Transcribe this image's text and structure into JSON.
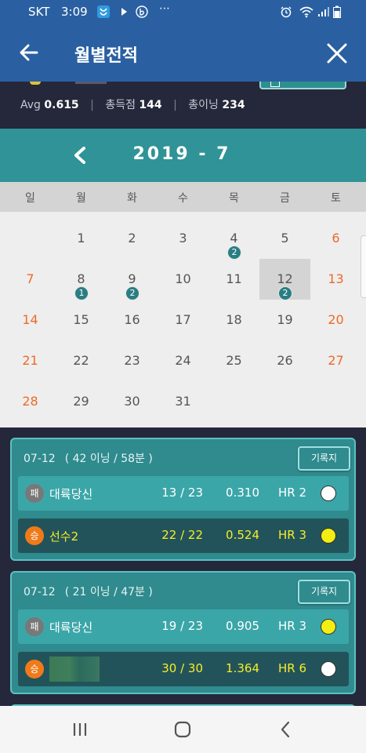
{
  "status_bar": {
    "carrier": "SKT",
    "time": "3:09",
    "dots": "⋯",
    "icons": [
      "notification-icon",
      "play-icon",
      "b-app-icon",
      "alarm-icon",
      "wifi-icon",
      "signal-icon",
      "battery-icon"
    ]
  },
  "app_bar": {
    "title": "월별전적",
    "back_icon": "arrow-left-icon",
    "close_icon": "close-icon"
  },
  "summary": {
    "avg_label": "Avg",
    "avg_value": "0.615",
    "runs_label": "총득점",
    "runs_value": "144",
    "innings_label": "총이닝",
    "innings_value": "234",
    "sep": "|"
  },
  "calendar": {
    "month_label": "2019 - 7",
    "weekdays": [
      "일",
      "월",
      "화",
      "수",
      "목",
      "금",
      "토"
    ],
    "days": [
      {
        "d": "1",
        "col": 1,
        "row": 0
      },
      {
        "d": "2",
        "col": 2,
        "row": 0
      },
      {
        "d": "3",
        "col": 3,
        "row": 0
      },
      {
        "d": "4",
        "col": 4,
        "row": 0,
        "badge": "2"
      },
      {
        "d": "5",
        "col": 5,
        "row": 0
      },
      {
        "d": "6",
        "col": 6,
        "row": 0
      },
      {
        "d": "7",
        "col": 0,
        "row": 1
      },
      {
        "d": "8",
        "col": 1,
        "row": 1,
        "badge": "1"
      },
      {
        "d": "9",
        "col": 2,
        "row": 1,
        "badge": "2"
      },
      {
        "d": "10",
        "col": 3,
        "row": 1
      },
      {
        "d": "11",
        "col": 4,
        "row": 1
      },
      {
        "d": "12",
        "col": 5,
        "row": 1,
        "badge": "2",
        "selected": true
      },
      {
        "d": "13",
        "col": 6,
        "row": 1
      },
      {
        "d": "14",
        "col": 0,
        "row": 2
      },
      {
        "d": "15",
        "col": 1,
        "row": 2
      },
      {
        "d": "16",
        "col": 2,
        "row": 2
      },
      {
        "d": "17",
        "col": 3,
        "row": 2
      },
      {
        "d": "18",
        "col": 4,
        "row": 2
      },
      {
        "d": "19",
        "col": 5,
        "row": 2
      },
      {
        "d": "20",
        "col": 6,
        "row": 2
      },
      {
        "d": "21",
        "col": 0,
        "row": 3
      },
      {
        "d": "22",
        "col": 1,
        "row": 3
      },
      {
        "d": "23",
        "col": 2,
        "row": 3
      },
      {
        "d": "24",
        "col": 3,
        "row": 3
      },
      {
        "d": "25",
        "col": 4,
        "row": 3
      },
      {
        "d": "26",
        "col": 5,
        "row": 3
      },
      {
        "d": "27",
        "col": 6,
        "row": 3
      },
      {
        "d": "28",
        "col": 0,
        "row": 4
      },
      {
        "d": "29",
        "col": 1,
        "row": 4
      },
      {
        "d": "30",
        "col": 2,
        "row": 4
      },
      {
        "d": "31",
        "col": 3,
        "row": 4
      }
    ]
  },
  "games": [
    {
      "date": "07-12",
      "info": "( 42 이닝 / 58분 )",
      "record_button": "기록지",
      "players": [
        {
          "result": "패",
          "name": "대륙당신",
          "score": "13 / 23",
          "avg": "0.310",
          "hr": "HR 2",
          "dot_color": "#ffffff"
        },
        {
          "result": "승",
          "name": "선수2",
          "score": "22 / 22",
          "avg": "0.524",
          "hr": "HR 3",
          "dot_color": "#f2ee12"
        }
      ]
    },
    {
      "date": "07-12",
      "info": "( 21 이닝 / 47분 )",
      "record_button": "기록지",
      "players": [
        {
          "result": "패",
          "name": "대륙당신",
          "score": "19 / 23",
          "avg": "0.905",
          "hr": "HR 3",
          "dot_color": "#f2ee12"
        },
        {
          "result": "승",
          "name": "",
          "score": "30 / 30",
          "avg": "1.364",
          "hr": "HR 6",
          "dot_color": "#ffffff",
          "name_blurred": true
        }
      ]
    }
  ],
  "colors": {
    "appbar": "#2a60a2",
    "teal": "#2f9397",
    "weekend": "#ee6a28",
    "highlight": "#f4ee2a"
  },
  "nav_bar": {
    "icons": [
      "recent-apps-icon",
      "home-icon",
      "back-icon"
    ]
  }
}
